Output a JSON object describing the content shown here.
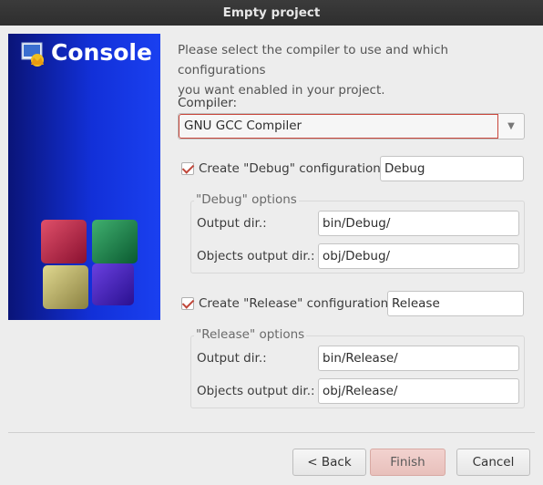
{
  "window": {
    "title": "Empty project"
  },
  "banner": {
    "title": "Console",
    "logo_icon": "codeblocks-logo-icon",
    "art_icon": "colored-cubes-icon"
  },
  "intro": {
    "line1": "Please select the compiler to use and which configurations",
    "line2": "you want enabled in your project."
  },
  "compiler": {
    "label": "Compiler:",
    "value": "GNU GCC Compiler"
  },
  "debug": {
    "checkbox_label": "Create \"Debug\" configuration:",
    "checked": true,
    "name_value": "Debug",
    "group_title": "\"Debug\" options",
    "output_label": "Output dir.:",
    "output_value": "bin/Debug/",
    "objects_label": "Objects output dir.:",
    "objects_value": "obj/Debug/"
  },
  "release": {
    "checkbox_label": "Create \"Release\" configuration:",
    "checked": true,
    "name_value": "Release",
    "group_title": "\"Release\" options",
    "output_label": "Output dir.:",
    "output_value": "bin/Release/",
    "objects_label": "Objects output dir.:",
    "objects_value": "obj/Release/"
  },
  "buttons": {
    "back": "< Back",
    "finish": "Finish",
    "cancel": "Cancel"
  },
  "colors": {
    "accent": "#c8453a",
    "banner": "#1230d8",
    "finish_bg": "#eac5c0"
  }
}
